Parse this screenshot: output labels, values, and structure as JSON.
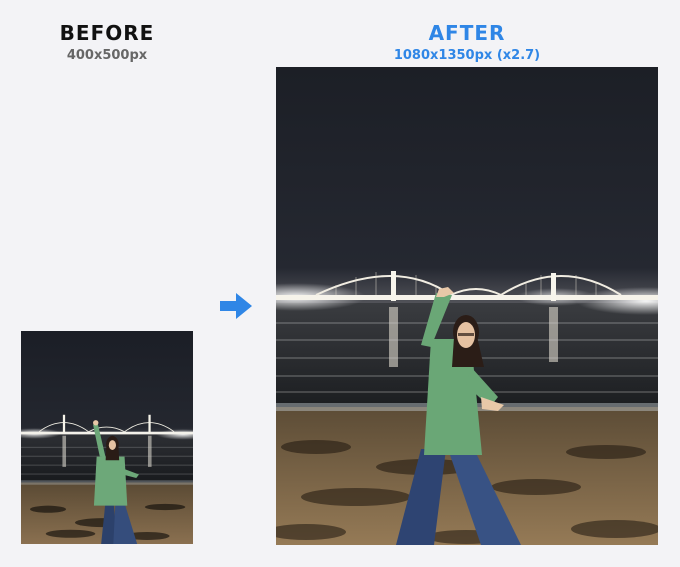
{
  "before": {
    "title": "BEFORE",
    "dimensions": "400x500px"
  },
  "after": {
    "title": "AFTER",
    "dimensions": "1080x1350px",
    "scale": "(x2.7)"
  },
  "colors": {
    "accent": "#2f86e6",
    "background": "#f3f3f6",
    "before_title": "#111111",
    "before_subtitle": "#666666"
  },
  "icons": {
    "arrow": "arrow-right-icon"
  },
  "photo_description_for_render": "night beach scene"
}
